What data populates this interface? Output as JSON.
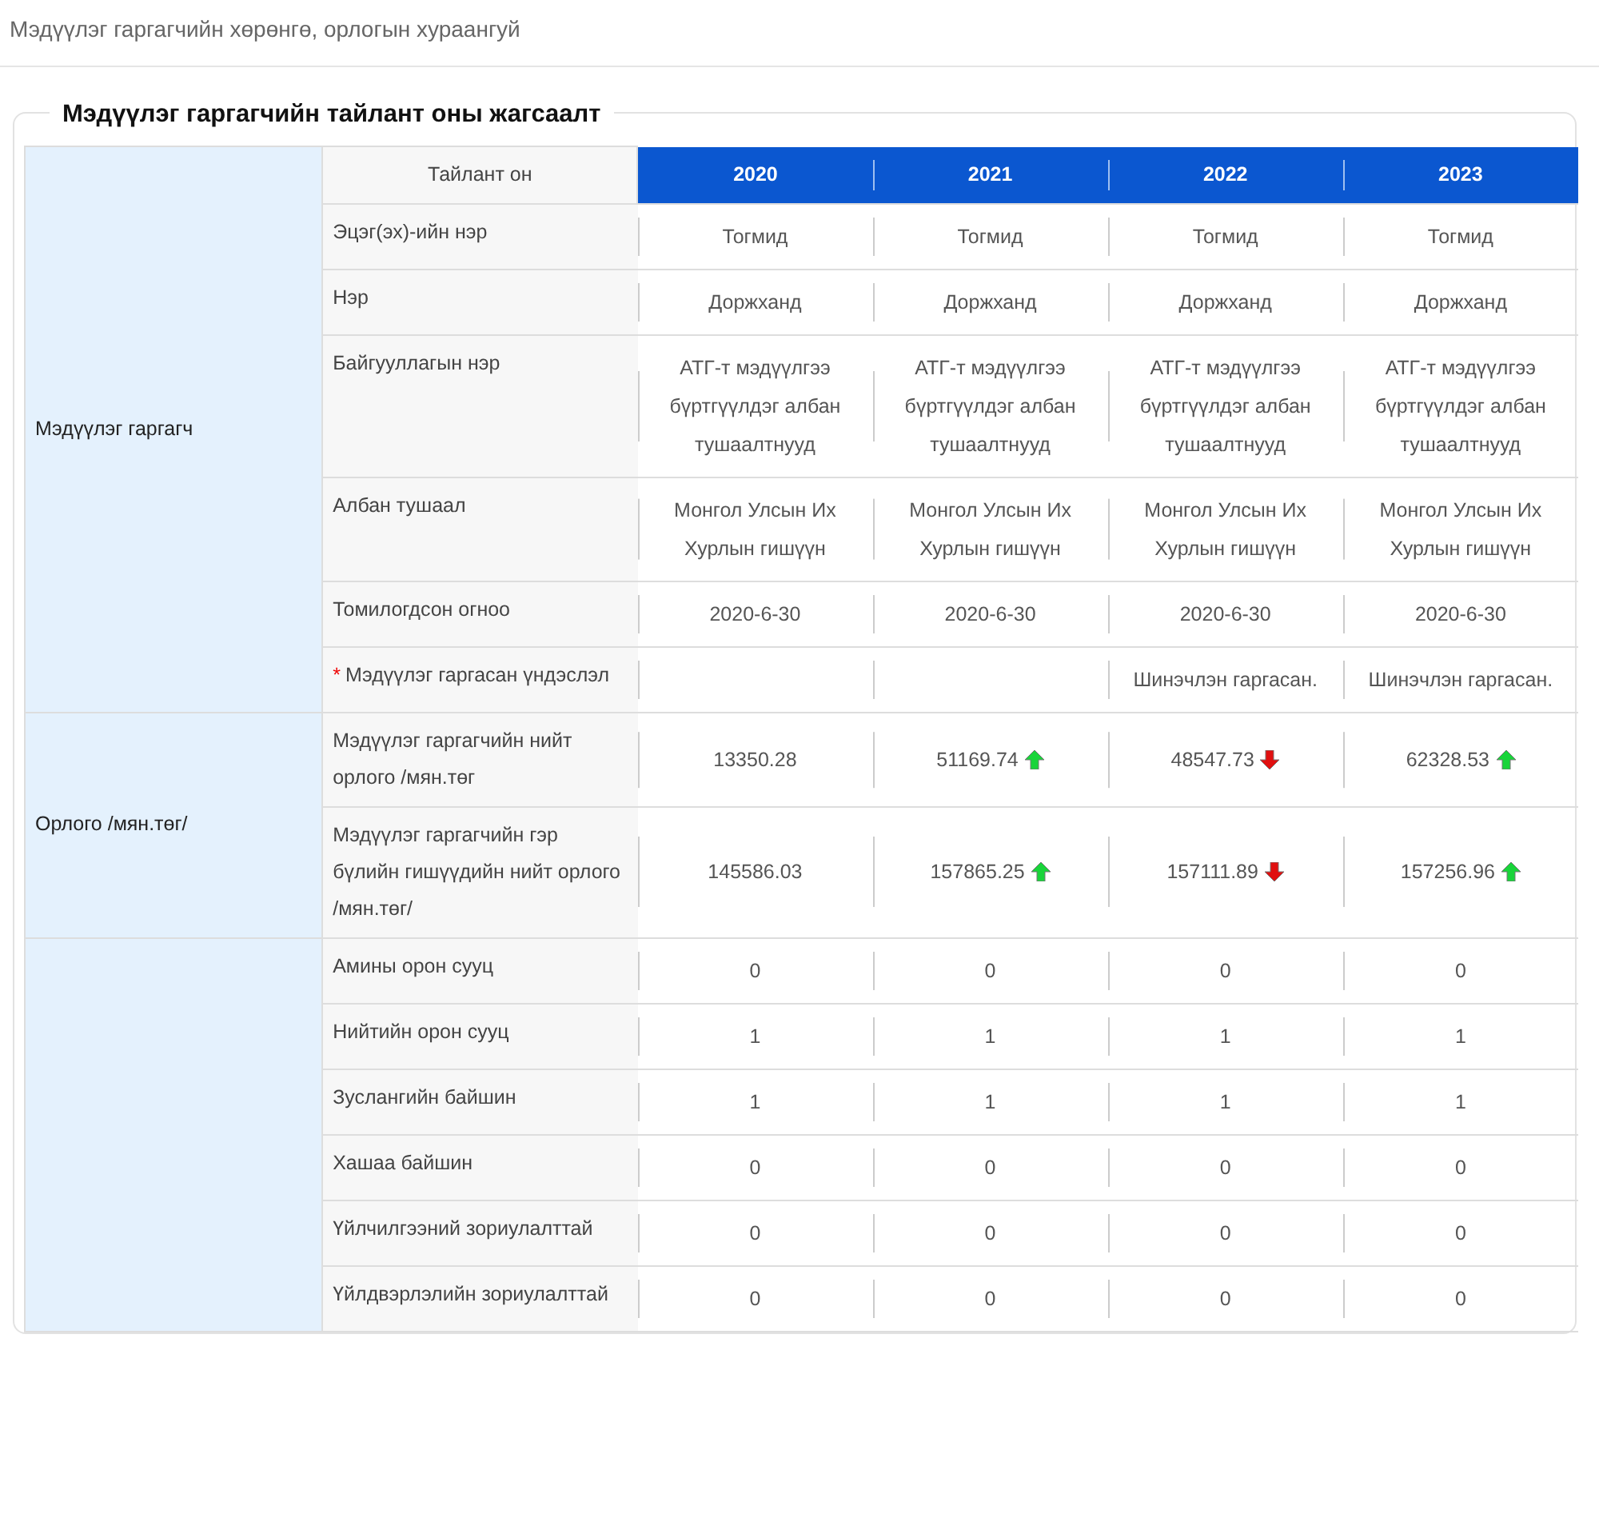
{
  "page_title": "Мэдүүлэг гаргагчийн хөрөнгө, орлогын хураангуй",
  "section_title": "Мэдүүлэг гаргагчийн тайлант оны жагсаалт",
  "header": {
    "label": "Тайлант он",
    "years": [
      "2020",
      "2021",
      "2022",
      "2023"
    ]
  },
  "groups": [
    {
      "title": "Мэдүүлэг гаргагч",
      "rows": [
        {
          "label": "Эцэг(эх)-ийн нэр",
          "cells": [
            {
              "value": "Тогмид"
            },
            {
              "value": "Тогмид"
            },
            {
              "value": "Тогмид"
            },
            {
              "value": "Тогмид"
            }
          ]
        },
        {
          "label": "Нэр",
          "cells": [
            {
              "value": "Доржханд"
            },
            {
              "value": "Доржханд"
            },
            {
              "value": "Доржханд"
            },
            {
              "value": "Доржханд"
            }
          ]
        },
        {
          "label": "Байгууллагын нэр",
          "cells": [
            {
              "value": "АТГ-т мэдүүлгээ бүртгүүлдэг албан тушаалтнууд"
            },
            {
              "value": "АТГ-т мэдүүлгээ бүртгүүлдэг албан тушаалтнууд"
            },
            {
              "value": "АТГ-т мэдүүлгээ бүртгүүлдэг албан тушаалтнууд"
            },
            {
              "value": "АТГ-т мэдүүлгээ бүртгүүлдэг албан тушаалтнууд"
            }
          ]
        },
        {
          "label": "Албан тушаал",
          "cells": [
            {
              "value": "Монгол Улсын Их Хурлын гишүүн"
            },
            {
              "value": "Монгол Улсын Их Хурлын гишүүн"
            },
            {
              "value": "Монгол Улсын Их Хурлын гишүүн"
            },
            {
              "value": "Монгол Улсын Их Хурлын гишүүн"
            }
          ]
        },
        {
          "label": "Томилогдсон огноо",
          "cells": [
            {
              "value": "2020-6-30"
            },
            {
              "value": "2020-6-30"
            },
            {
              "value": "2020-6-30"
            },
            {
              "value": "2020-6-30"
            }
          ]
        },
        {
          "label": "Мэдүүлэг гаргасан үндэслэл",
          "required_mark": "*",
          "cells": [
            {},
            {},
            {
              "value": "Шинэчлэн гаргасан."
            },
            {
              "value": "Шинэчлэн гаргасан."
            }
          ]
        }
      ]
    },
    {
      "title": "Орлого /мян.төг/",
      "rows": [
        {
          "label": "Мэдүүлэг гаргагчийн нийт орлого /мян.төг",
          "cells": [
            {
              "value": "13350.28"
            },
            {
              "value": "51169.74",
              "increased": true
            },
            {
              "value": "48547.73",
              "increased": false
            },
            {
              "value": "62328.53",
              "increased": true
            }
          ]
        },
        {
          "label": "Мэдүүлэг гаргагчийн гэр бүлийн гишүүдийн нийт орлого /мян.төг/",
          "cells": [
            {
              "value": "145586.03"
            },
            {
              "value": "157865.25",
              "increased": true
            },
            {
              "value": "157111.89",
              "increased": false
            },
            {
              "value": "157256.96",
              "increased": true
            }
          ]
        }
      ]
    },
    {
      "rows": [
        {
          "label": "Амины орон сууц",
          "cells": [
            {
              "value": "0"
            },
            {
              "value": "0"
            },
            {
              "value": "0"
            },
            {
              "value": "0"
            }
          ]
        },
        {
          "label": "Нийтийн орон сууц",
          "cells": [
            {
              "value": "1"
            },
            {
              "value": "1"
            },
            {
              "value": "1"
            },
            {
              "value": "1"
            }
          ]
        },
        {
          "label": "Зуслангийн байшин",
          "cells": [
            {
              "value": "1"
            },
            {
              "value": "1"
            },
            {
              "value": "1"
            },
            {
              "value": "1"
            }
          ]
        },
        {
          "label": "Хашаа байшин",
          "cells": [
            {
              "value": "0"
            },
            {
              "value": "0"
            },
            {
              "value": "0"
            },
            {
              "value": "0"
            }
          ]
        },
        {
          "label": "Үйлчилгээний зориулалттай",
          "cells": [
            {
              "value": "0"
            },
            {
              "value": "0"
            },
            {
              "value": "0"
            },
            {
              "value": "0"
            }
          ]
        },
        {
          "label": "Үйлдвэрлэлийн зориулалттай",
          "cells": [
            {
              "value": "0"
            },
            {
              "value": "0"
            },
            {
              "value": "0"
            },
            {
              "value": "0"
            }
          ]
        }
      ]
    }
  ]
}
